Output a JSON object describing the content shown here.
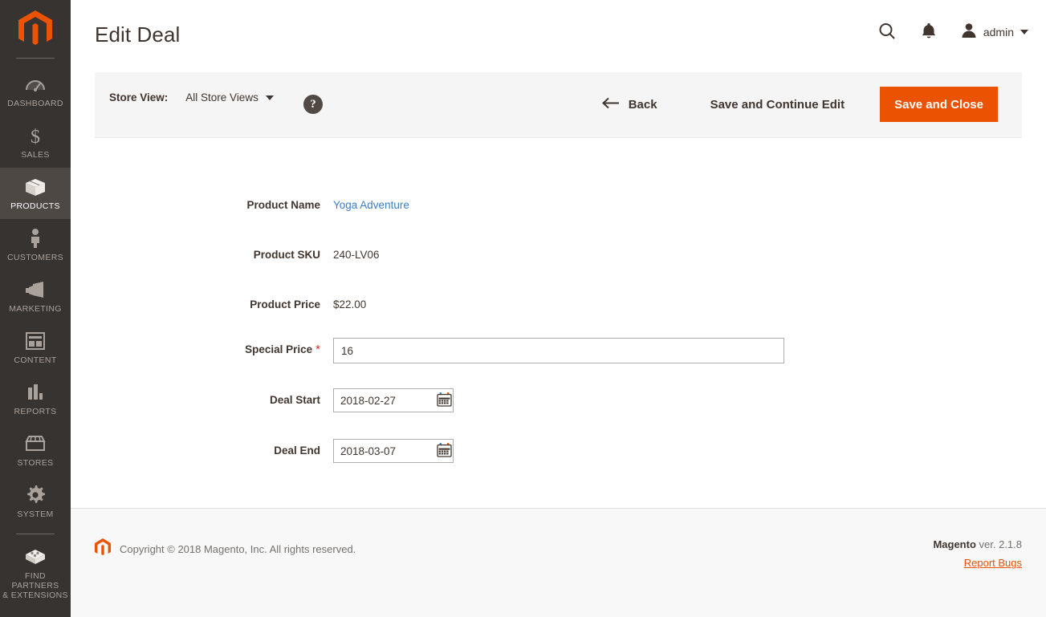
{
  "sidebar": {
    "logo": "magento-logo",
    "items": [
      {
        "label": "Dashboard",
        "icon": "dashboard-icon",
        "active": false
      },
      {
        "label": "Sales",
        "icon": "dollar-icon",
        "active": false
      },
      {
        "label": "Products",
        "icon": "box-icon",
        "active": true
      },
      {
        "label": "Customers",
        "icon": "person-icon",
        "active": false
      },
      {
        "label": "Marketing",
        "icon": "megaphone-icon",
        "active": false
      },
      {
        "label": "Content",
        "icon": "layout-icon",
        "active": false
      },
      {
        "label": "Reports",
        "icon": "bar-chart-icon",
        "active": false
      },
      {
        "label": "Stores",
        "icon": "storefront-icon",
        "active": false
      },
      {
        "label": "System",
        "icon": "gear-icon",
        "active": false
      },
      {
        "label": "Find Partners\n& Extensions",
        "icon": "extension-icon",
        "active": false
      }
    ]
  },
  "header": {
    "title": "Edit Deal",
    "search_icon": "search-icon",
    "notifications_icon": "bell-icon",
    "account_icon": "user-avatar-icon",
    "account_name": "admin"
  },
  "toolbar": {
    "store_view_label": "Store View:",
    "store_view_value": "All Store Views",
    "help_label": "?",
    "back_label": "Back",
    "save_continue_label": "Save and Continue Edit",
    "save_close_label": "Save and Close"
  },
  "form": {
    "fields": [
      {
        "label": "Product Name",
        "value": "Yoga Adventure",
        "type": "link",
        "required": false
      },
      {
        "label": "Product SKU",
        "value": "240-LV06",
        "type": "text",
        "required": false
      },
      {
        "label": "Product Price",
        "value": "$22.00",
        "type": "text",
        "required": false
      },
      {
        "label": "Special Price",
        "value": "16",
        "type": "input",
        "required": true
      },
      {
        "label": "Deal Start",
        "value": "2018-02-27",
        "type": "date",
        "required": false
      },
      {
        "label": "Deal End",
        "value": "2018-03-07",
        "type": "date",
        "required": false
      }
    ]
  },
  "footer": {
    "copyright": "Copyright © 2018 Magento, Inc. All rights reserved.",
    "version_brand": "Magento",
    "version_text": " ver. 2.1.8",
    "report_bugs": "Report Bugs"
  },
  "colors": {
    "accent_orange": "#eb5202",
    "sidebar_bg": "#373330",
    "link_blue": "#3a7ec7",
    "required_red": "#e02b27"
  }
}
